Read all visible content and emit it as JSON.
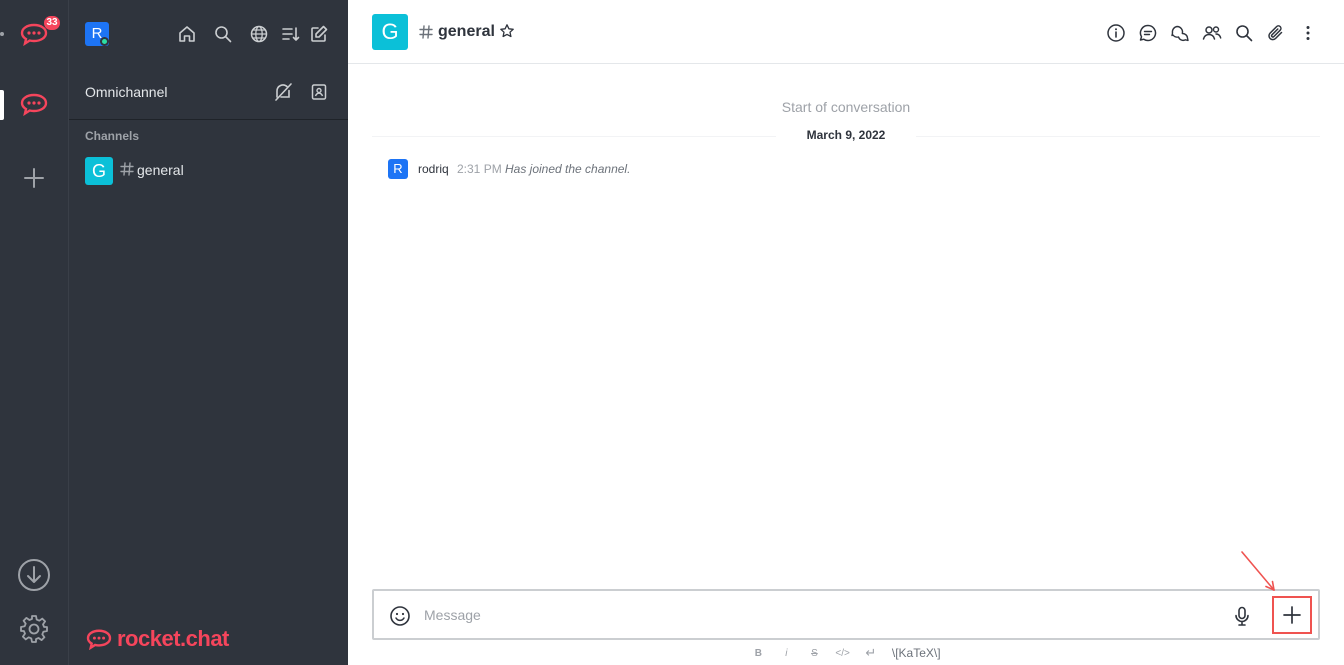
{
  "rail": {
    "notification_badge": "33",
    "icons": [
      "rocket-chat-server-icon",
      "rocket-chat-server-active-icon",
      "add-server-icon",
      "download-icon",
      "settings-gear-icon"
    ]
  },
  "sidebar": {
    "user_avatar_letter": "R",
    "user_status": "online",
    "header_icons": [
      "home-icon",
      "search-icon",
      "directory-globe-icon",
      "sort-icon",
      "create-new-icon"
    ],
    "omnichannel": {
      "label": "Omnichannel",
      "icons": [
        "omnichannel-unavailable-icon",
        "contact-center-icon"
      ]
    },
    "section_title": "Channels",
    "rooms": [
      {
        "avatar_letter": "G",
        "name": "general"
      }
    ],
    "brand": "rocket.chat"
  },
  "room": {
    "avatar_letter": "G",
    "title": "general",
    "toolbar_icons": [
      "room-info-icon",
      "discussion-icon",
      "threads-icon",
      "members-icon",
      "search-messages-icon",
      "files-icon",
      "kebab-menu-icon"
    ]
  },
  "timeline": {
    "start_label": "Start of conversation",
    "date_label": "March 9, 2022",
    "messages": [
      {
        "avatar_letter": "R",
        "user": "rodriq",
        "time": "2:31 PM",
        "text": "Has joined the channel."
      }
    ]
  },
  "composer": {
    "placeholder": "Message",
    "format_items": [
      "B",
      "i",
      "S",
      "</>",
      "↵"
    ],
    "katex_label": "\\[KaTeX\\]"
  },
  "colors": {
    "sidebar_bg": "#2f343d",
    "brand_red": "#f5455c",
    "room_avatar": "#0bc0d8",
    "user_avatar": "#1d74f5",
    "highlight": "#ef5350"
  }
}
